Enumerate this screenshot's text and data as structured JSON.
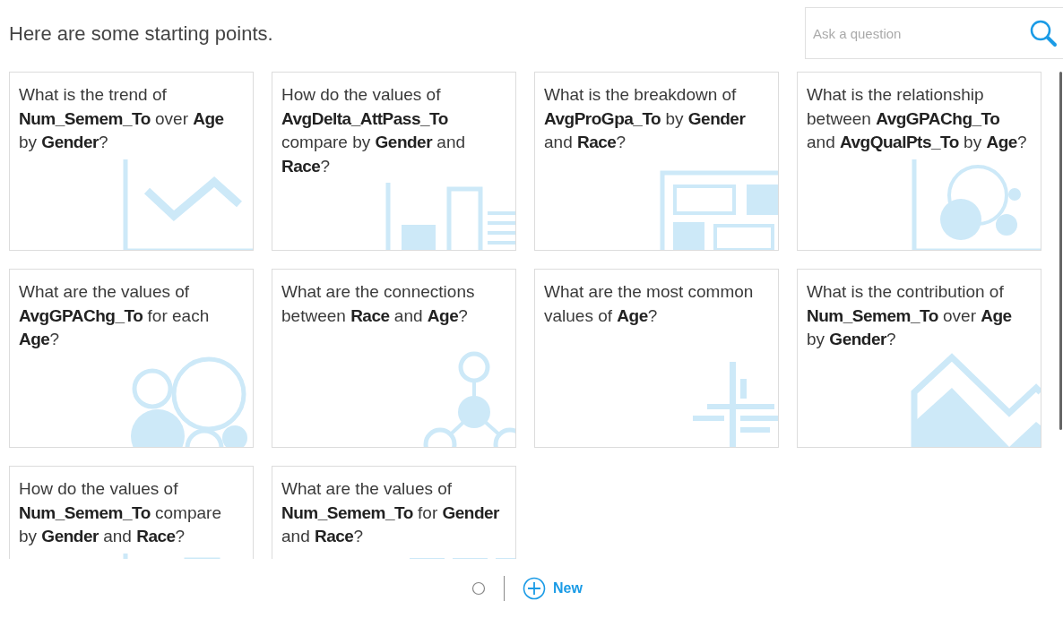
{
  "heading": "Here are some starting points.",
  "search": {
    "placeholder": "Ask a question"
  },
  "cards": [
    {
      "question": "What is the trend of **Num_Semem_To** over **Age** by **Gender**?",
      "kind": "line"
    },
    {
      "question": "How do the values of **AvgDelta_AttPass_To** compare by **Gender** and **Race**?",
      "kind": "bar"
    },
    {
      "question": "What is the breakdown of **AvgProGpa_To** by **Gender** and **Race**?",
      "kind": "treemap"
    },
    {
      "question": "What is the relationship between **AvgGPAChg_To** and **AvgQualPts_To** by **Age**?",
      "kind": "scatter"
    },
    {
      "question": "What are the values of **AvgGPAChg_To** for each **Age**?",
      "kind": "bubble"
    },
    {
      "question": "What are the connections between **Race** and **Age**?",
      "kind": "network"
    },
    {
      "question": "What are the most common values of **Age**?",
      "kind": "histogram"
    },
    {
      "question": "What is the contribution of **Num_Semem_To** over **Age** by **Gender**?",
      "kind": "area"
    },
    {
      "question": "How do the values of **Num_Semem_To** compare by **Gender** and **Race**?",
      "kind": "bar"
    },
    {
      "question": "What are the values of **Num_Semem_To** for **Gender** and **Race**?",
      "kind": "table"
    }
  ],
  "footer": {
    "new_button": "New"
  }
}
